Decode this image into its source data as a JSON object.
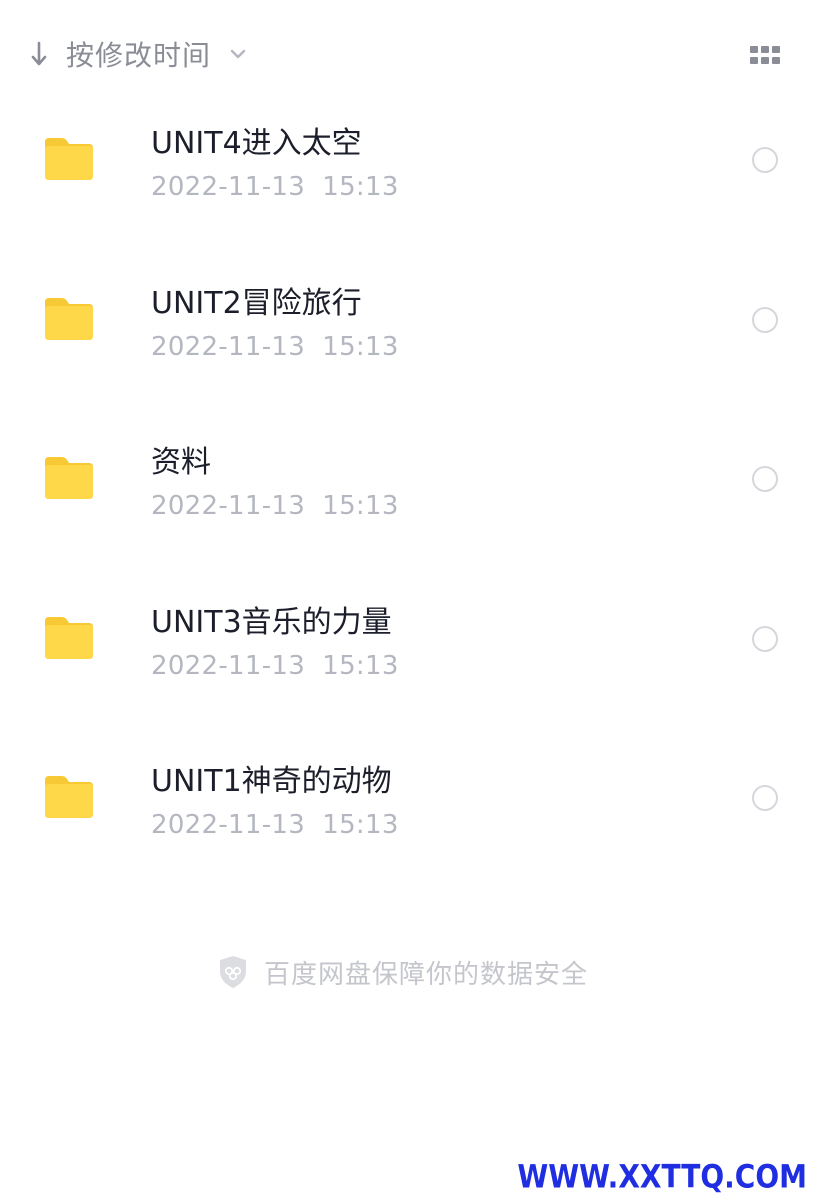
{
  "toolbar": {
    "sort_label": "按修改时间",
    "sort_icon": "arrow-down-icon",
    "chevron_icon": "chevron-down-icon",
    "view_toggle_icon": "grid-view-icon"
  },
  "files": [
    {
      "name": "UNIT4进入太空",
      "date": "2022-11-13  15:13",
      "icon": "folder-icon"
    },
    {
      "name": "UNIT2冒险旅行",
      "date": "2022-11-13  15:13",
      "icon": "folder-icon"
    },
    {
      "name": "资料",
      "date": "2022-11-13  15:13",
      "icon": "folder-icon"
    },
    {
      "name": "UNIT3音乐的力量",
      "date": "2022-11-13  15:13",
      "icon": "folder-icon"
    },
    {
      "name": "UNIT1神奇的动物",
      "date": "2022-11-13  15:13",
      "icon": "folder-icon"
    }
  ],
  "footer": {
    "safety_text": "百度网盘保障你的数据安全",
    "icon": "shield-icon"
  },
  "watermark": {
    "text": "WWW.XXTTQ.COM"
  },
  "colors": {
    "folder": "#ffd84a",
    "folder_tab": "#f7c934",
    "title_text": "#1c1f2b",
    "date_text": "#b4b7c0",
    "toolbar_text": "#8a8d96",
    "watermark": "#1f2ee0"
  }
}
